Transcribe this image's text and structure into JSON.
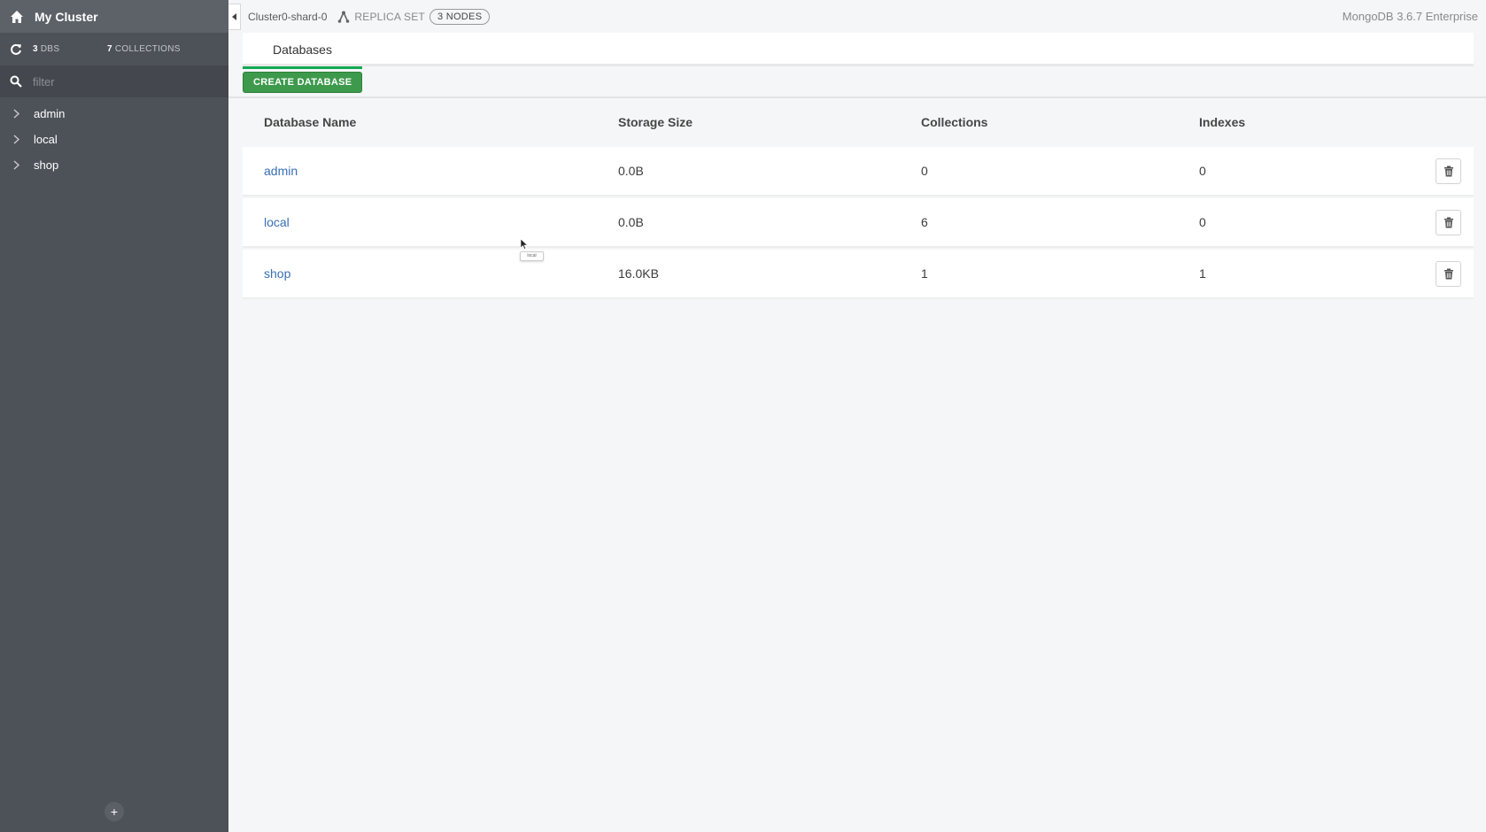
{
  "sidebar": {
    "title": "My Cluster",
    "stats": {
      "dbs_count": "3",
      "dbs_label": "DBS",
      "collections_count": "7",
      "collections_label": "COLLECTIONS"
    },
    "filter_placeholder": "filter",
    "databases": [
      {
        "label": "admin"
      },
      {
        "label": "local"
      },
      {
        "label": "shop"
      }
    ],
    "add_label": "+"
  },
  "topbar": {
    "cluster_name": "Cluster0-shard-0",
    "topology_label": "REPLICA SET",
    "nodes_label": "3 NODES",
    "version": "MongoDB 3.6.7 Enterprise"
  },
  "tabs": [
    {
      "label": "Databases",
      "active": true
    }
  ],
  "toolbar": {
    "create_label": "CREATE DATABASE"
  },
  "table": {
    "columns": [
      "Database Name",
      "Storage Size",
      "Collections",
      "Indexes"
    ],
    "rows": [
      {
        "name": "admin",
        "storage": "0.0B",
        "collections": "0",
        "indexes": "0"
      },
      {
        "name": "local",
        "storage": "0.0B",
        "collections": "6",
        "indexes": "0"
      },
      {
        "name": "shop",
        "storage": "16.0KB",
        "collections": "1",
        "indexes": "1"
      }
    ]
  },
  "tooltip": "local",
  "colors": {
    "accent": "#13aa52",
    "button": "#3d9a4c",
    "sidebar": "#4d5259",
    "link": "#3a6fb4"
  },
  "icons": {
    "title": "home-icon",
    "stats": "refresh-icon",
    "filter": "search-icon",
    "row_action": "trash-icon",
    "topology": "replica-set-icon"
  }
}
